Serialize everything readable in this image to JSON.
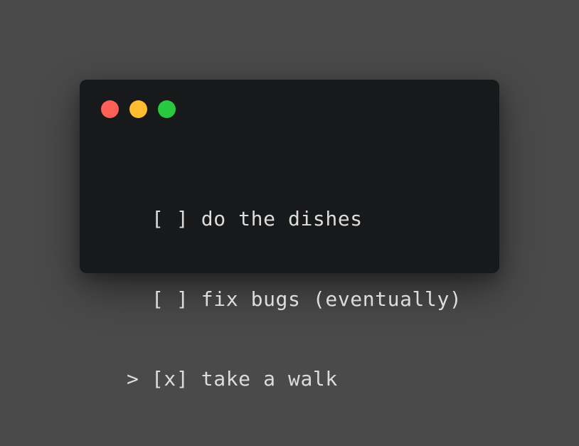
{
  "window": {
    "traffic_lights": [
      {
        "name": "close",
        "color": "#fe5f57"
      },
      {
        "name": "minimize",
        "color": "#febc2e"
      },
      {
        "name": "zoom",
        "color": "#28c840"
      }
    ]
  },
  "terminal": {
    "lines": [
      {
        "cursor": " ",
        "checkbox": "[ ]",
        "text": "do the dishes"
      },
      {
        "cursor": " ",
        "checkbox": "[ ]",
        "text": "fix bugs (eventually)"
      },
      {
        "cursor": ">",
        "checkbox": "[x]",
        "text": "take a walk"
      }
    ]
  }
}
